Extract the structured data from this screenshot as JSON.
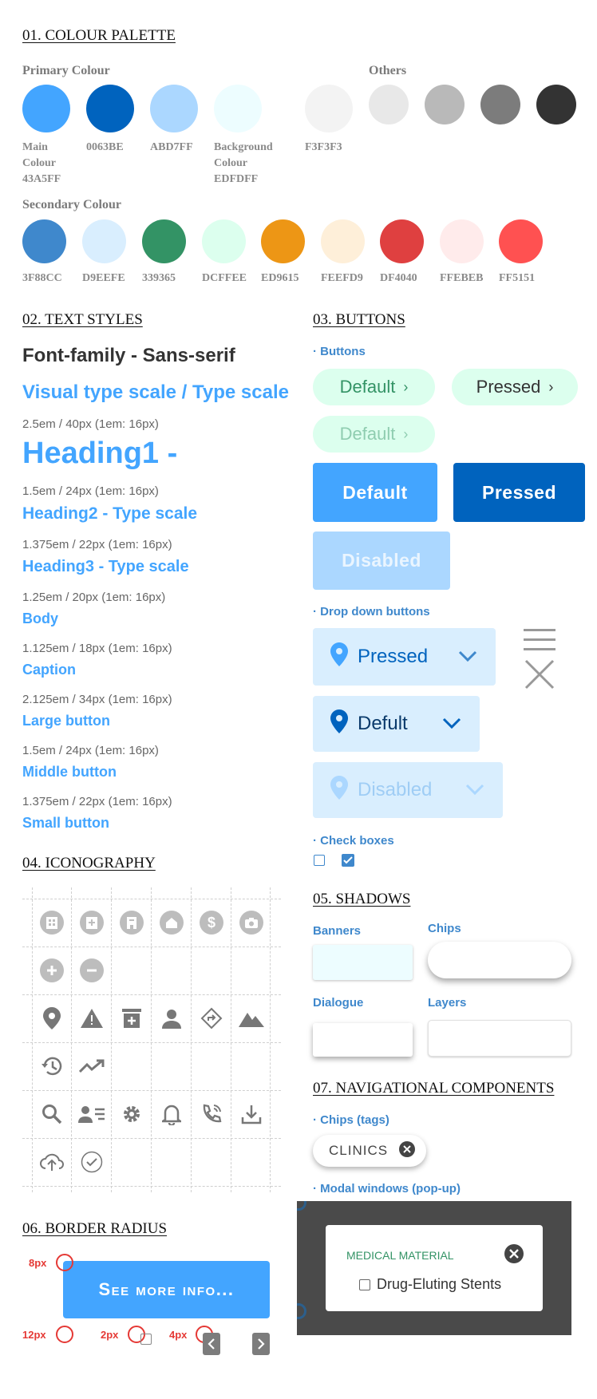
{
  "sections": {
    "colour_palette": "01. COLOUR PALETTE",
    "text_styles": "02. TEXT STYLES",
    "buttons": "03. BUTTONS",
    "iconography": "04. ICONOGRAPHY",
    "shadows": "05. SHADOWS",
    "border_radius": "06. BORDER RADIUS",
    "navigational": "07. NAVIGATIONAL COMPONENTS"
  },
  "palette": {
    "primary_title": "Primary Colour",
    "others_title": "Others",
    "secondary_title": "Secondary Colour",
    "primary": [
      {
        "label": "Main\nColour\n43A5FF",
        "color": "#43A5FF"
      },
      {
        "label": "0063BE",
        "color": "#0063BE"
      },
      {
        "label": "ABD7FF",
        "color": "#ABD7FF"
      },
      {
        "label": "Background\nColour\nEDFDFF",
        "color": "#EDFDFF"
      },
      {
        "label": "F3F3F3",
        "color": "#F3F3F3"
      }
    ],
    "others": [
      "#E8E8E8",
      "#B9B9B9",
      "#7C7C7C",
      "#333333"
    ],
    "secondary": [
      {
        "label": "3F88CC",
        "color": "#3F88CC"
      },
      {
        "label": "D9EEFE",
        "color": "#D9EEFE"
      },
      {
        "label": "339365",
        "color": "#339365"
      },
      {
        "label": "DCFFEE",
        "color": "#DCFFEE"
      },
      {
        "label": "ED9615",
        "color": "#ED9615"
      },
      {
        "label": "FEEFD9",
        "color": "#FEEFD9"
      },
      {
        "label": "DF4040",
        "color": "#DF4040"
      },
      {
        "label": "FFEBEB",
        "color": "#FFEBEB"
      },
      {
        "label": "FF5151",
        "color": "#FF5151"
      }
    ]
  },
  "text_styles": {
    "font_family": "Font-family - Sans-serif",
    "type_scale": "Visual type scale / Type scale",
    "h1_spec": "2.5em / 40px (1em: 16px)",
    "h1": "Heading1 -",
    "h2_spec": "1.5em / 24px (1em: 16px)",
    "h2": "Heading2 - Type scale",
    "h3_spec": "1.375em / 22px (1em: 16px)",
    "h3": "Heading3 - Type scale",
    "body_spec": "1.25em / 20px (1em: 16px)",
    "body": "Body",
    "caption_spec": "1.125em / 18px (1em: 16px)",
    "caption": "Caption",
    "large_spec": "2.125em / 34px (1em: 16px)",
    "large": "Large button",
    "middle_spec": "1.5em / 24px (1em: 16px)",
    "middle": "Middle button",
    "small_spec": "1.375em / 22px (1em: 16px)",
    "small": "Small button"
  },
  "buttons": {
    "sub_buttons": "· Buttons",
    "pill_default": "Default",
    "pill_pressed": "Pressed",
    "pill_disabled": "Default",
    "big_default": "Default",
    "big_pressed": "Pressed",
    "big_disabled": "Disabled",
    "sub_dropdown": "· Drop down buttons",
    "dd_pressed": "Pressed",
    "dd_default": "Deful​t",
    "dd_disabled": "Disabled",
    "sub_checkboxes": "· Check boxes"
  },
  "shadows": {
    "banners": "Banners",
    "chips": "Chips",
    "dialogue": "Dialogue",
    "layers": "Layers"
  },
  "navigational": {
    "chips_title": "· Chips (tags)",
    "chip_label": "CLINICS",
    "modal_title": "· Modal windows (pop-up)",
    "modal_heading": "MEDICAL MATERIAL",
    "modal_option": "Drug-Eluting Stents"
  },
  "border_radius": {
    "button_label": "See more info...",
    "r8": "8px",
    "r12": "12px",
    "r2": "2px",
    "r4": "4px"
  }
}
